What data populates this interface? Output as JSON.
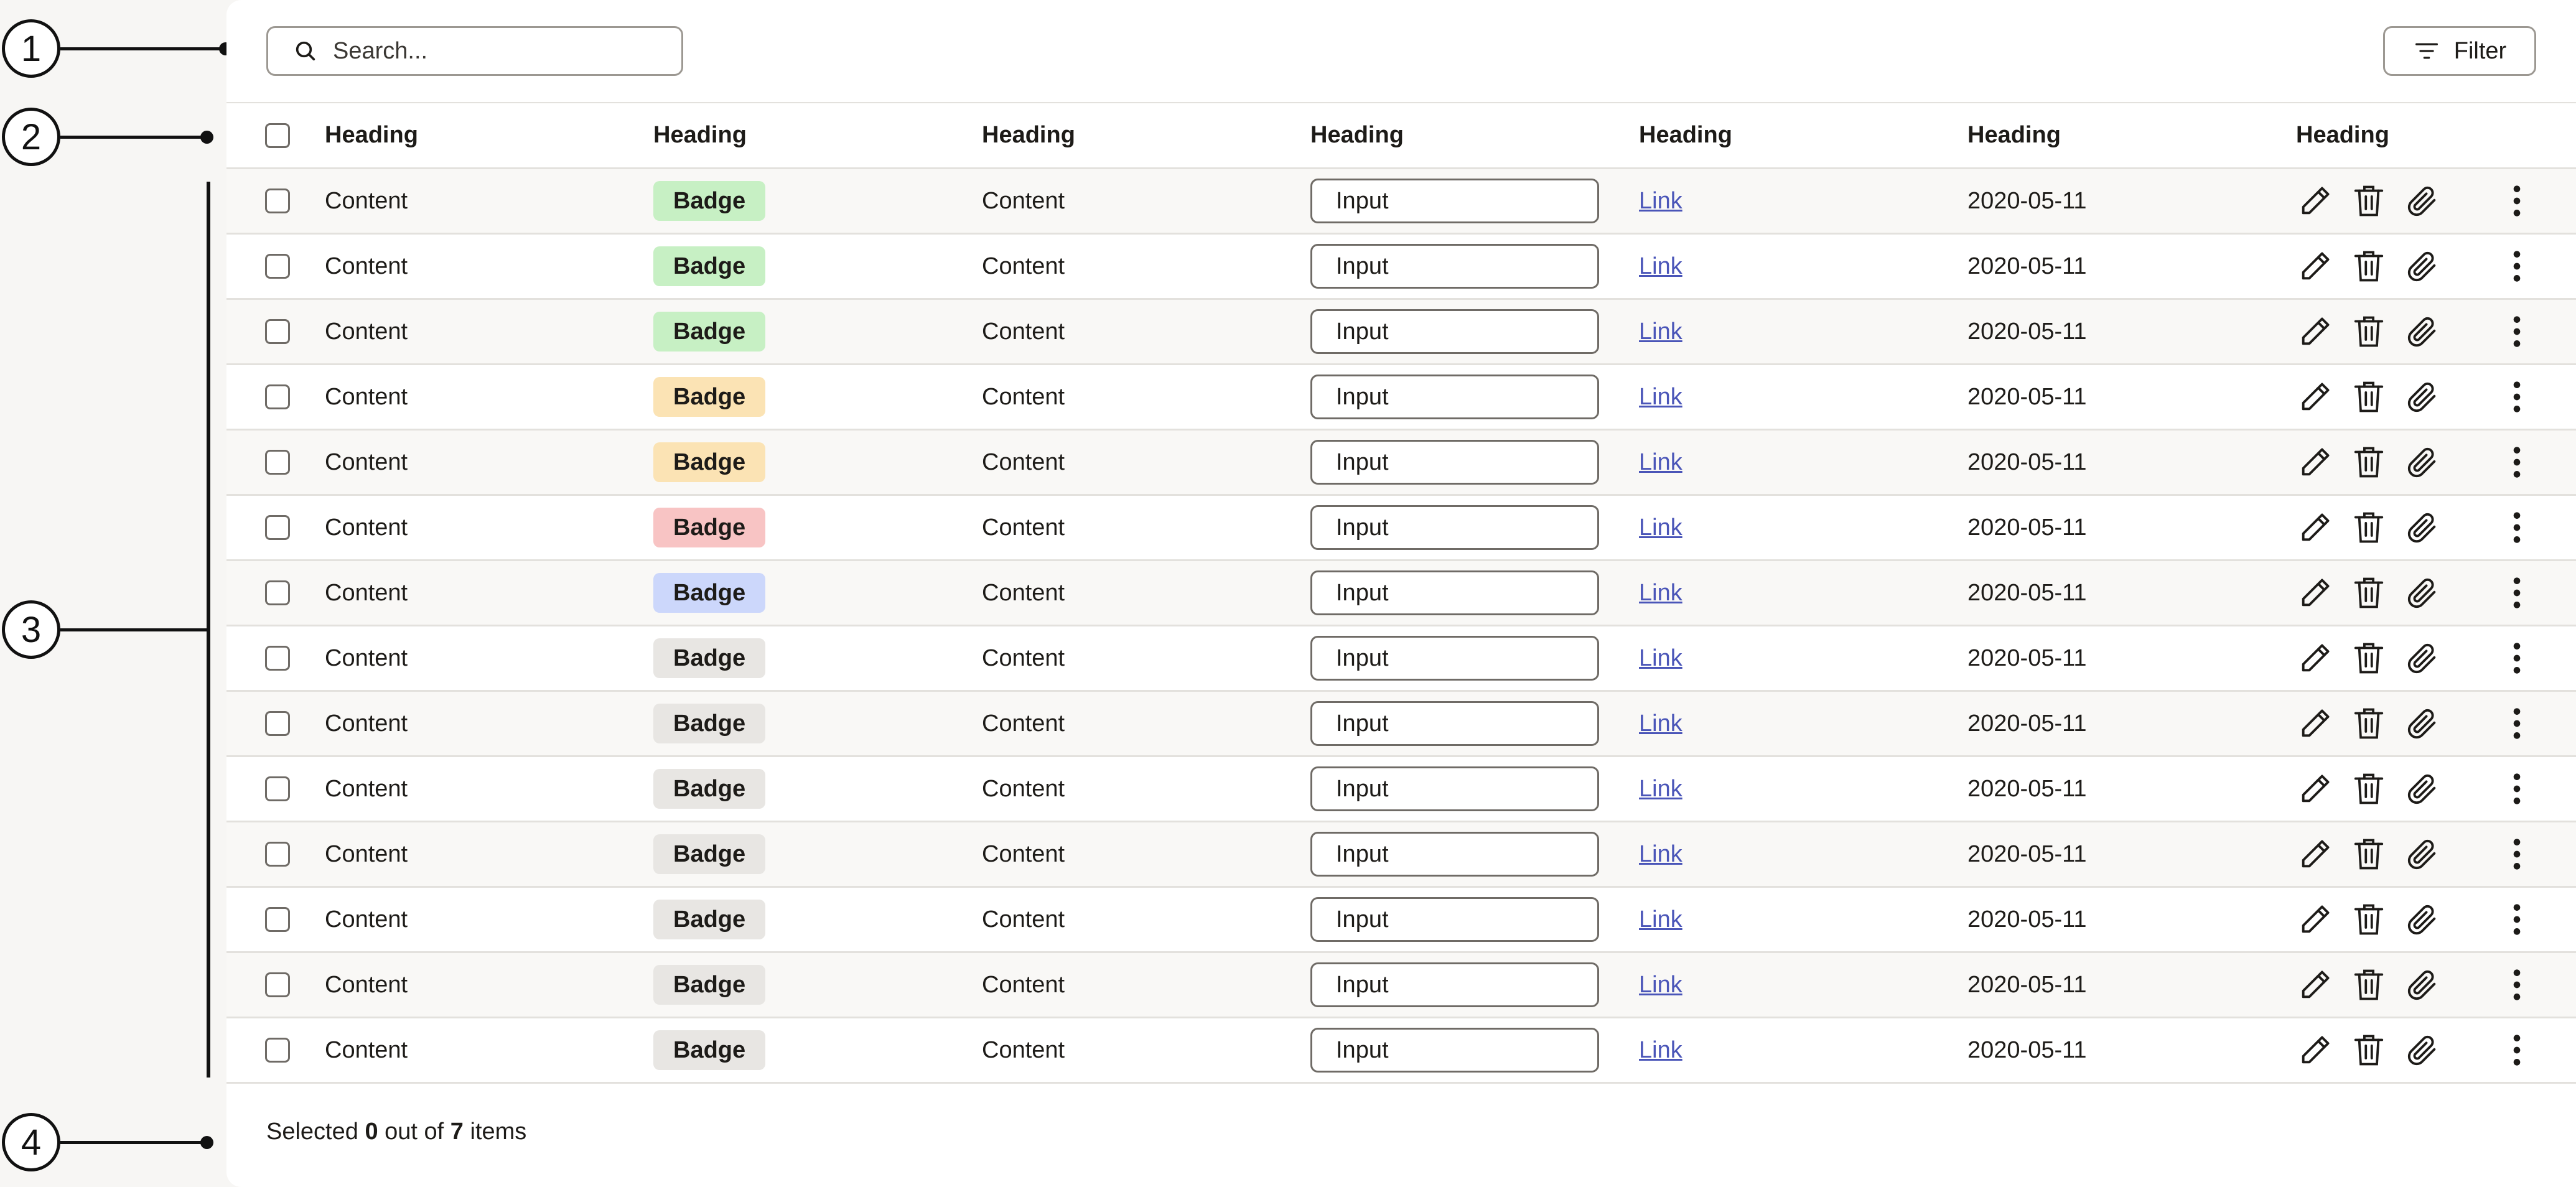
{
  "annotations": [
    "1",
    "2",
    "3",
    "4"
  ],
  "toolbar": {
    "search_placeholder": "Search...",
    "filter_label": "Filter"
  },
  "table": {
    "headers": [
      "Heading",
      "Heading",
      "Heading",
      "Heading",
      "Heading",
      "Heading",
      "Heading"
    ],
    "rows": [
      {
        "content1": "Content",
        "badge": "Badge",
        "badge_color": "#c7f0c4",
        "content2": "Content",
        "input": "Input",
        "link": "Link",
        "date": "2020-05-11"
      },
      {
        "content1": "Content",
        "badge": "Badge",
        "badge_color": "#c7f0c4",
        "content2": "Content",
        "input": "Input",
        "link": "Link",
        "date": "2020-05-11"
      },
      {
        "content1": "Content",
        "badge": "Badge",
        "badge_color": "#c7f0c4",
        "content2": "Content",
        "input": "Input",
        "link": "Link",
        "date": "2020-05-11"
      },
      {
        "content1": "Content",
        "badge": "Badge",
        "badge_color": "#fbe3b4",
        "content2": "Content",
        "input": "Input",
        "link": "Link",
        "date": "2020-05-11"
      },
      {
        "content1": "Content",
        "badge": "Badge",
        "badge_color": "#fbe3b4",
        "content2": "Content",
        "input": "Input",
        "link": "Link",
        "date": "2020-05-11"
      },
      {
        "content1": "Content",
        "badge": "Badge",
        "badge_color": "#f8c4c4",
        "content2": "Content",
        "input": "Input",
        "link": "Link",
        "date": "2020-05-11"
      },
      {
        "content1": "Content",
        "badge": "Badge",
        "badge_color": "#ccd7fb",
        "content2": "Content",
        "input": "Input",
        "link": "Link",
        "date": "2020-05-11"
      },
      {
        "content1": "Content",
        "badge": "Badge",
        "badge_color": "#e8e6e3",
        "content2": "Content",
        "input": "Input",
        "link": "Link",
        "date": "2020-05-11"
      },
      {
        "content1": "Content",
        "badge": "Badge",
        "badge_color": "#e8e6e3",
        "content2": "Content",
        "input": "Input",
        "link": "Link",
        "date": "2020-05-11"
      },
      {
        "content1": "Content",
        "badge": "Badge",
        "badge_color": "#e8e6e3",
        "content2": "Content",
        "input": "Input",
        "link": "Link",
        "date": "2020-05-11"
      },
      {
        "content1": "Content",
        "badge": "Badge",
        "badge_color": "#e8e6e3",
        "content2": "Content",
        "input": "Input",
        "link": "Link",
        "date": "2020-05-11"
      },
      {
        "content1": "Content",
        "badge": "Badge",
        "badge_color": "#e8e6e3",
        "content2": "Content",
        "input": "Input",
        "link": "Link",
        "date": "2020-05-11"
      },
      {
        "content1": "Content",
        "badge": "Badge",
        "badge_color": "#e8e6e3",
        "content2": "Content",
        "input": "Input",
        "link": "Link",
        "date": "2020-05-11"
      },
      {
        "content1": "Content",
        "badge": "Badge",
        "badge_color": "#e8e6e3",
        "content2": "Content",
        "input": "Input",
        "link": "Link",
        "date": "2020-05-11"
      }
    ],
    "row_icons": [
      "pencil-icon",
      "trash-icon",
      "paperclip-icon",
      "more-vertical-icon"
    ]
  },
  "footer": {
    "prefix": "Selected",
    "selected": "0",
    "middle": "out of",
    "total": "7",
    "suffix": "items"
  },
  "colors": {
    "link": "#4a55b8",
    "border": "#9c9892",
    "row_alt": "#f9f8f6"
  }
}
